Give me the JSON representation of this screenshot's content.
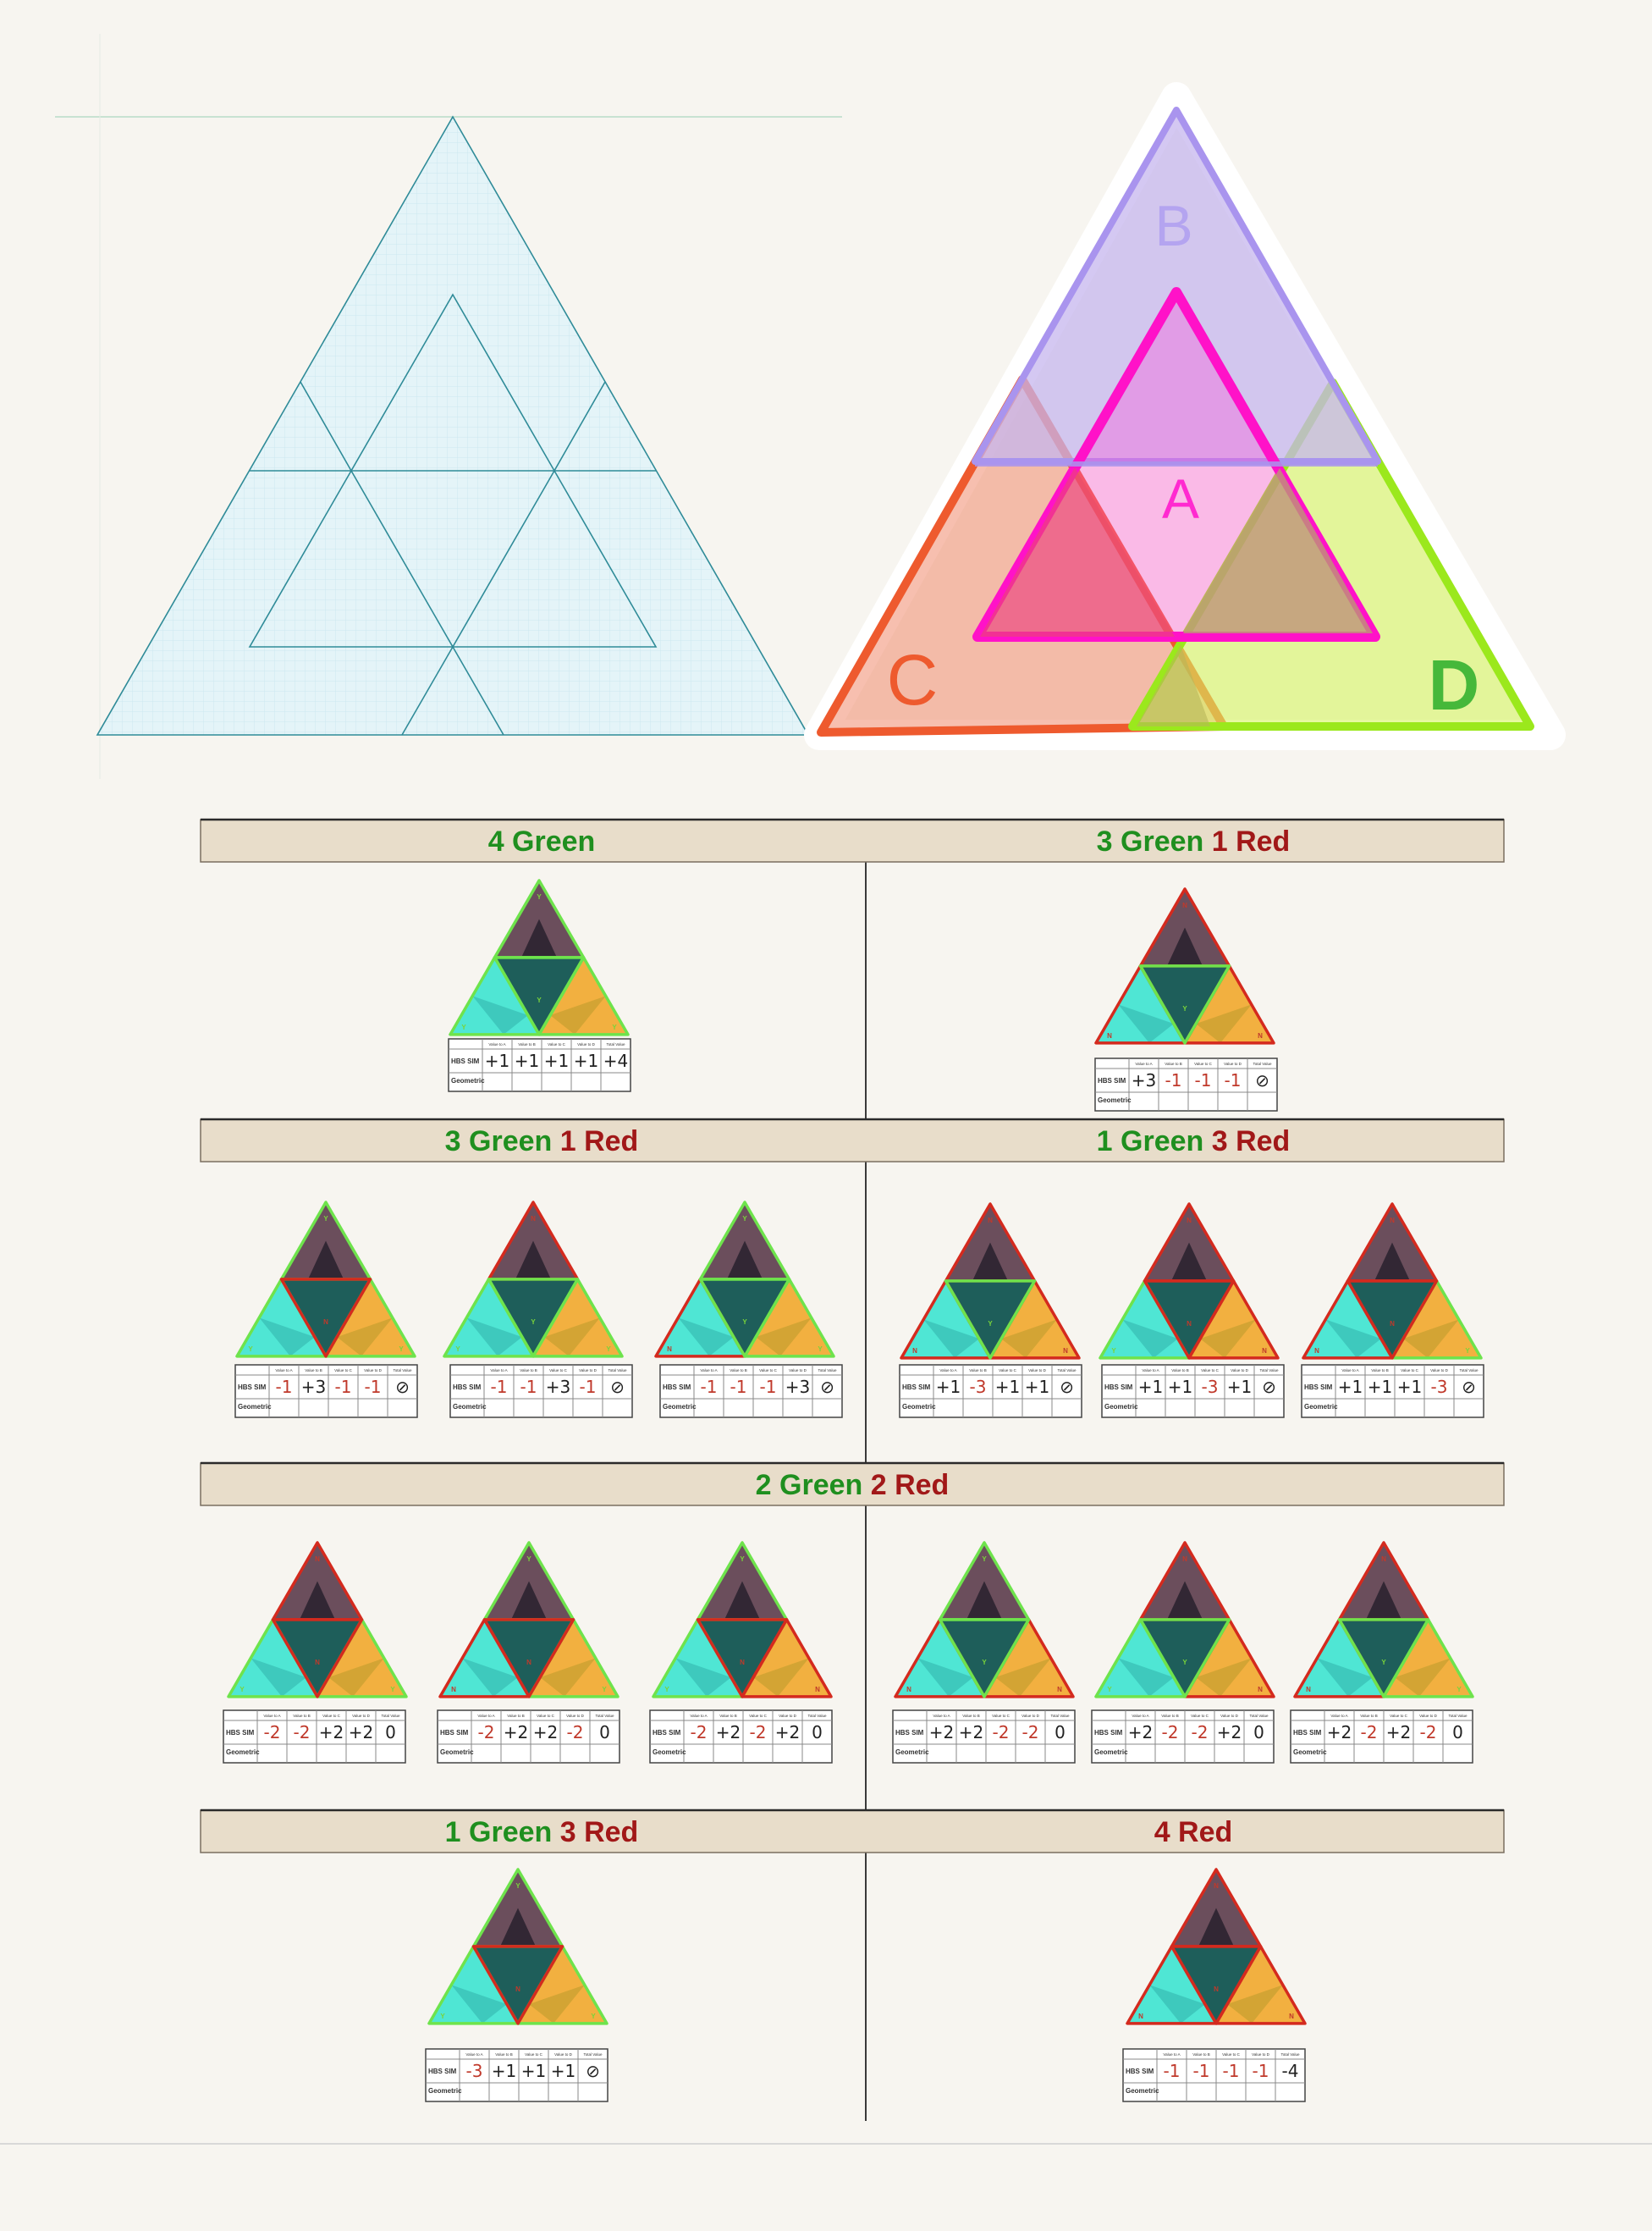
{
  "colors": {
    "background": "#f7f5f0",
    "header_bg": "#e8ddca",
    "green_text": "#1f8f1f",
    "red_text": "#a11818",
    "value_red": "#c0392b",
    "value_black": "#222222",
    "grid_blue": "#dceff5",
    "B_fill": "#c8b8ec",
    "A_stroke": "#ff12c8",
    "C_stroke": "#ee5a2e",
    "D_stroke": "#9be81c"
  },
  "top_right": {
    "label_a": "A",
    "label_b": "B",
    "label_c": "C",
    "label_d": "D"
  },
  "table_labels": {
    "row1": "HBS SIM",
    "row2": "Geometric",
    "headers": [
      "Value to A",
      "Value to B",
      "Value to C",
      "Value to D",
      "Total Value"
    ]
  },
  "sections": [
    {
      "headers": [
        [
          {
            "t": "4 Green",
            "c": "g"
          }
        ],
        [
          {
            "t": "3 Green",
            "c": "g"
          },
          {
            "t": "1 Red",
            "c": "r"
          }
        ]
      ]
    },
    {
      "headers": [
        [
          {
            "t": "3 Green",
            "c": "g"
          },
          {
            "t": "1 Red",
            "c": "r"
          }
        ],
        [
          {
            "t": "1 Green",
            "c": "g"
          },
          {
            "t": "3 Red",
            "c": "r"
          }
        ]
      ]
    },
    {
      "headers": [
        [
          {
            "t": "2 Green",
            "c": "g"
          },
          {
            "t": "2 Red",
            "c": "r"
          }
        ]
      ]
    },
    {
      "headers": [
        [
          {
            "t": "1 Green",
            "c": "g"
          },
          {
            "t": "3 Red",
            "c": "r"
          }
        ],
        [
          {
            "t": "4 Red",
            "c": "r"
          }
        ]
      ]
    }
  ],
  "items": [
    {
      "edges": "gggg",
      "values": [
        "+1",
        "+1",
        "+1",
        "+1",
        "+4"
      ]
    },
    {
      "edges": "grrr",
      "values": [
        "+3",
        "-1",
        "-1",
        "-1",
        "⊘"
      ]
    },
    {
      "edges": "rggg",
      "values": [
        "-1",
        "+3",
        "-1",
        "-1",
        "⊘"
      ]
    },
    {
      "edges": "grgg",
      "values": [
        "-1",
        "-1",
        "+3",
        "-1",
        "⊘"
      ]
    },
    {
      "edges": "ggrg",
      "values": [
        "-1",
        "-1",
        "-1",
        "+3",
        "⊘"
      ]
    },
    {
      "edges": "grrr",
      "values": [
        "+1",
        "-3",
        "+1",
        "+1",
        "⊘"
      ]
    },
    {
      "edges": "rrgr",
      "values": [
        "+1",
        "+1",
        "-3",
        "+1",
        "⊘"
      ]
    },
    {
      "edges": "rrrg",
      "values": [
        "+1",
        "+1",
        "+1",
        "-3",
        "⊘"
      ]
    },
    {
      "edges": "rrgg",
      "values": [
        "-2",
        "-2",
        "+2",
        "+2",
        "0"
      ]
    },
    {
      "edges": "rgrg",
      "values": [
        "-2",
        "+2",
        "+2",
        "-2",
        "0"
      ]
    },
    {
      "edges": "rggr",
      "values": [
        "-2",
        "+2",
        "-2",
        "+2",
        "0"
      ]
    },
    {
      "edges": "ggrr",
      "values": [
        "+2",
        "+2",
        "-2",
        "-2",
        "0"
      ]
    },
    {
      "edges": "grgr",
      "values": [
        "+2",
        "-2",
        "-2",
        "+2",
        "0"
      ]
    },
    {
      "edges": "grrg",
      "values": [
        "+2",
        "-2",
        "+2",
        "-2",
        "0"
      ]
    },
    {
      "edges": "rggg",
      "values": [
        "-3",
        "+1",
        "+1",
        "+1",
        "⊘"
      ]
    },
    {
      "edges": "rrrr",
      "values": [
        "-1",
        "-1",
        "-1",
        "-1",
        "-4"
      ]
    }
  ]
}
